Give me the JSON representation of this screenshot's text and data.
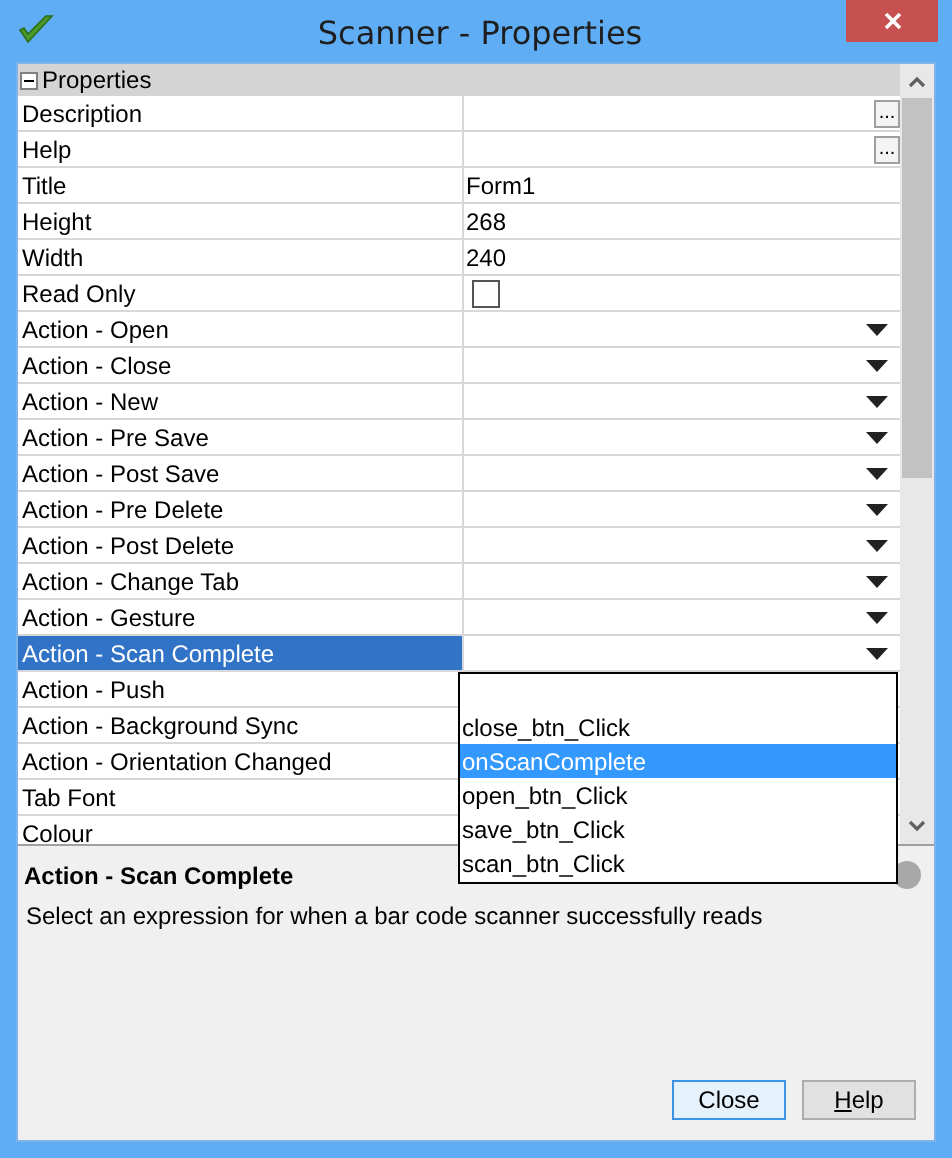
{
  "window": {
    "title": "Scanner - Properties"
  },
  "grid": {
    "section": {
      "label": "Properties",
      "expanded": true
    },
    "rows": [
      {
        "name": "Description",
        "kind": "ellipsis",
        "button": "...",
        "selected": false
      },
      {
        "name": "Help",
        "kind": "ellipsis",
        "button": "...",
        "selected": false
      },
      {
        "name": "Title",
        "kind": "text",
        "value": "Form1",
        "selected": false
      },
      {
        "name": "Height",
        "kind": "text",
        "value": "268",
        "selected": false
      },
      {
        "name": "Width",
        "kind": "text",
        "value": "240",
        "selected": false
      },
      {
        "name": "Read Only",
        "kind": "checkbox",
        "checked": false,
        "selected": false
      },
      {
        "name": "Action - Open",
        "kind": "dropdown",
        "selected": false
      },
      {
        "name": "Action - Close",
        "kind": "dropdown",
        "selected": false
      },
      {
        "name": "Action - New",
        "kind": "dropdown",
        "selected": false
      },
      {
        "name": "Action - Pre Save",
        "kind": "dropdown",
        "selected": false
      },
      {
        "name": "Action - Post Save",
        "kind": "dropdown",
        "selected": false
      },
      {
        "name": "Action - Pre Delete",
        "kind": "dropdown",
        "selected": false
      },
      {
        "name": "Action - Post Delete",
        "kind": "dropdown",
        "selected": false
      },
      {
        "name": "Action - Change Tab",
        "kind": "dropdown",
        "selected": false
      },
      {
        "name": "Action - Gesture",
        "kind": "dropdown",
        "selected": false
      },
      {
        "name": "Action - Scan Complete",
        "kind": "dropdown",
        "selected": true
      },
      {
        "name": "Action - Push",
        "kind": "text",
        "selected": false
      },
      {
        "name": "Action - Background Sync",
        "kind": "text",
        "selected": false
      },
      {
        "name": "Action - Orientation Changed",
        "kind": "text",
        "selected": false
      },
      {
        "name": "Tab Font",
        "kind": "text",
        "selected": false
      },
      {
        "name": "Colour",
        "kind": "text",
        "selected": false
      }
    ]
  },
  "dropdown_list": {
    "items": [
      {
        "label": "close_btn_Click",
        "selected": false
      },
      {
        "label": "onScanComplete",
        "selected": true
      },
      {
        "label": "open_btn_Click",
        "selected": false
      },
      {
        "label": "save_btn_Click",
        "selected": false
      },
      {
        "label": "scan_btn_Click",
        "selected": false
      }
    ]
  },
  "description": {
    "title": "Action - Scan Complete",
    "text": "Select an expression for when a bar code scanner successfully reads"
  },
  "buttons": [
    {
      "label": "Close",
      "default": true,
      "mnemonic": false
    },
    {
      "label": "Help",
      "default": false,
      "mnemonic": true
    }
  ]
}
